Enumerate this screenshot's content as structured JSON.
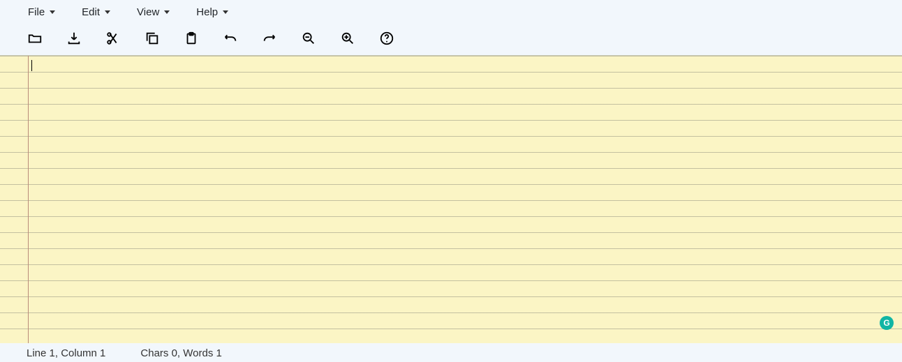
{
  "menubar": {
    "file": "File",
    "edit": "Edit",
    "view": "View",
    "help": "Help"
  },
  "toolbar": {
    "open": "Open",
    "save": "Save",
    "cut": "Cut",
    "copy": "Copy",
    "paste": "Paste",
    "undo": "Undo",
    "redo": "Redo",
    "zoom_out": "Zoom out",
    "zoom_in": "Zoom in",
    "help": "Help"
  },
  "editor": {
    "content": "",
    "line": 1,
    "column": 1,
    "chars": 0,
    "words": 1
  },
  "statusbar": {
    "position": "Line 1, Column 1",
    "counts": "Chars 0, Words 1"
  },
  "badge": {
    "label": "G"
  }
}
